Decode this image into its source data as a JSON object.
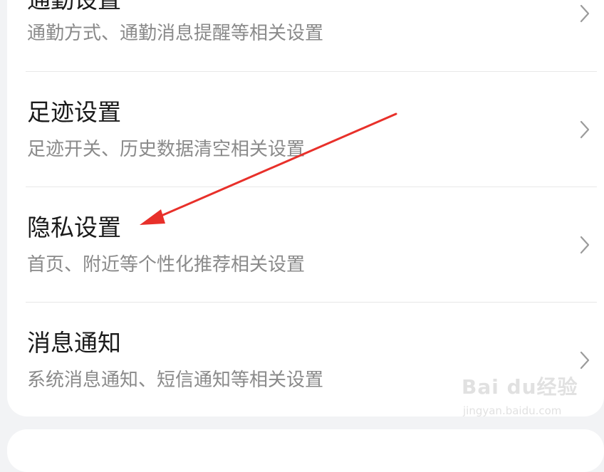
{
  "settings": {
    "items": [
      {
        "title": "通勤设置",
        "description": "通勤方式、通勤消息提醒等相关设置"
      },
      {
        "title": "足迹设置",
        "description": "足迹开关、历史数据清空相关设置"
      },
      {
        "title": "隐私设置",
        "description": "首页、附近等个性化推荐相关设置"
      },
      {
        "title": "消息通知",
        "description": "系统消息通知、短信通知等相关设置"
      }
    ]
  },
  "annotation": {
    "arrow_color": "#e8302a",
    "arrow_target": "隐私设置"
  },
  "watermark": {
    "logo": "Bai du经验",
    "url": "jingyan.baidu.com"
  },
  "colors": {
    "background": "#f2f3f5",
    "card": "#ffffff",
    "title_text": "#1a1a1a",
    "desc_text": "#8a8a8a",
    "chevron": "#9b9b9b"
  }
}
